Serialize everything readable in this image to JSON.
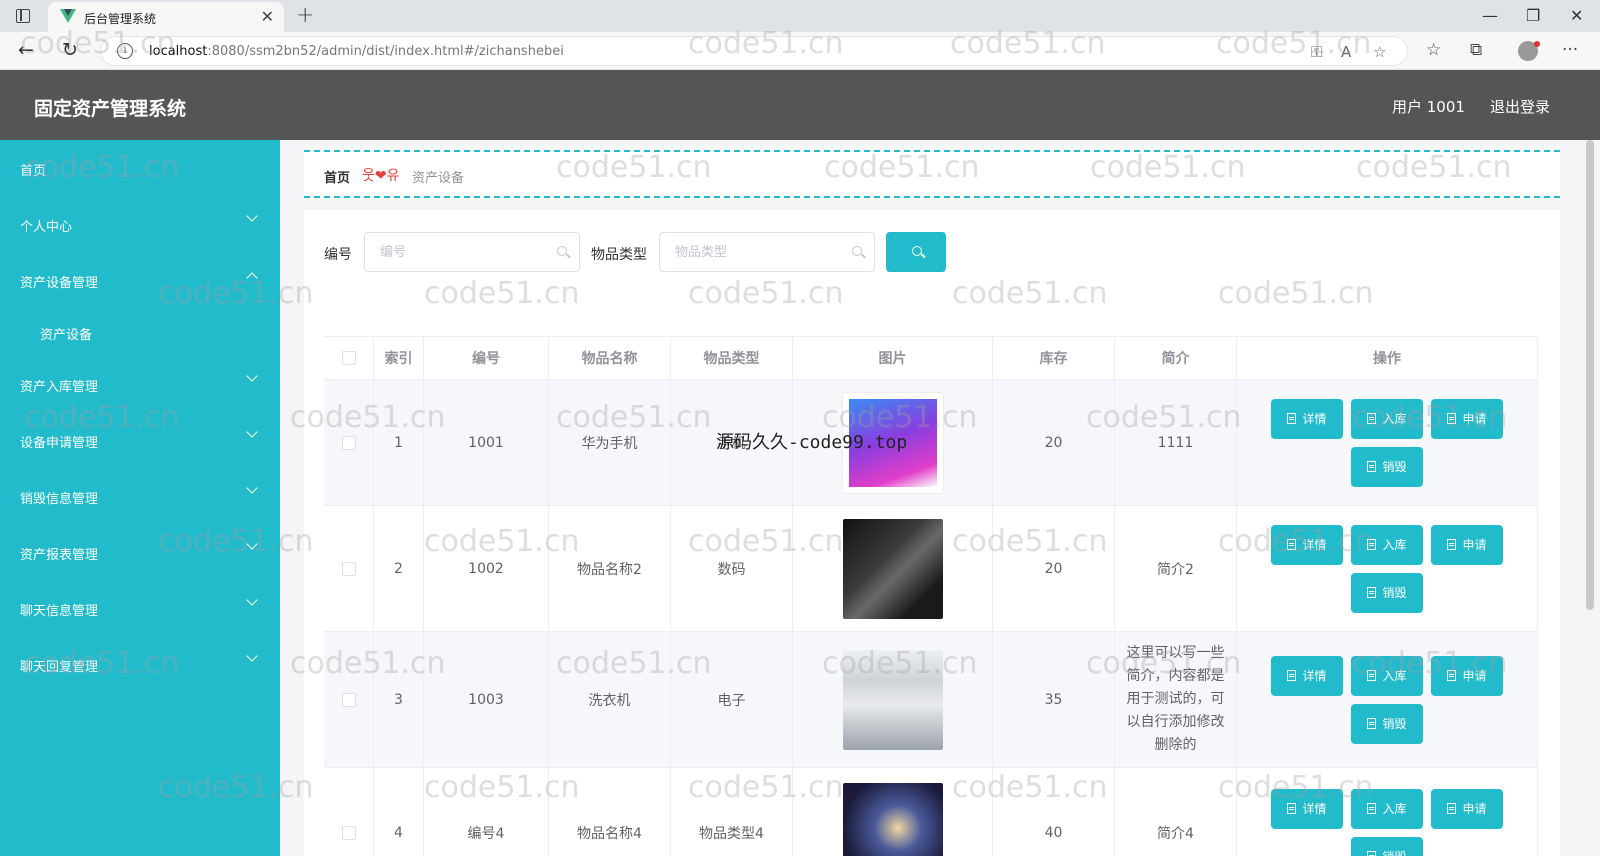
{
  "browser": {
    "tab_title": "后台管理系统",
    "url_host": "localhost",
    "url_rest": ":8080/ssm2bn52/admin/dist/index.html#/zichanshebei"
  },
  "header": {
    "title": "固定资产管理系统",
    "user": "用户 1001",
    "logout": "退出登录"
  },
  "sidebar": {
    "items": [
      {
        "label": "首页",
        "chevron": "none"
      },
      {
        "label": "个人中心",
        "chevron": "down"
      },
      {
        "label": "资产设备管理",
        "chevron": "up"
      },
      {
        "label": "资产设备",
        "chevron": "none"
      },
      {
        "label": "资产入库管理",
        "chevron": "down"
      },
      {
        "label": "设备申请管理",
        "chevron": "down"
      },
      {
        "label": "销毁信息管理",
        "chevron": "down"
      },
      {
        "label": "资产报表管理",
        "chevron": "down"
      },
      {
        "label": "聊天信息管理",
        "chevron": "down"
      },
      {
        "label": "聊天回复管理",
        "chevron": "down"
      }
    ]
  },
  "breadcrumb": {
    "home": "首页",
    "separator": "웃❤유",
    "current": "资产设备"
  },
  "search": {
    "label1": "编号",
    "placeholder1": "编号",
    "label2": "物品类型",
    "placeholder2": "物品类型"
  },
  "table": {
    "headers": [
      "索引",
      "编号",
      "物品名称",
      "物品类型",
      "图片",
      "库存",
      "简介",
      "操作"
    ],
    "rows": [
      {
        "index": "1",
        "code": "1001",
        "name": "华为手机",
        "type": "手机",
        "stock": "20",
        "brief": "1111",
        "image": "purple-phone"
      },
      {
        "index": "2",
        "code": "1002",
        "name": "物品名称2",
        "type": "数码",
        "stock": "20",
        "brief": "简介2",
        "image": "dark-phone"
      },
      {
        "index": "3",
        "code": "1003",
        "name": "洗衣机",
        "type": "电子",
        "stock": "35",
        "brief": "这里可以写一些简介，内容都是用于测试的，可以自行添加修改删除的",
        "image": "washing-machine"
      },
      {
        "index": "4",
        "code": "编号4",
        "name": "物品名称4",
        "type": "物品类型4",
        "stock": "40",
        "brief": "简介4",
        "image": "headphones"
      }
    ],
    "actions": {
      "detail": "详情",
      "stockin": "入库",
      "apply": "申请",
      "destroy": "销毁"
    }
  },
  "watermark": {
    "text": "code51.cn",
    "center": "源码久久-code99.top"
  },
  "colors": {
    "accent": "#22bbcc",
    "header_bg": "#555555"
  }
}
